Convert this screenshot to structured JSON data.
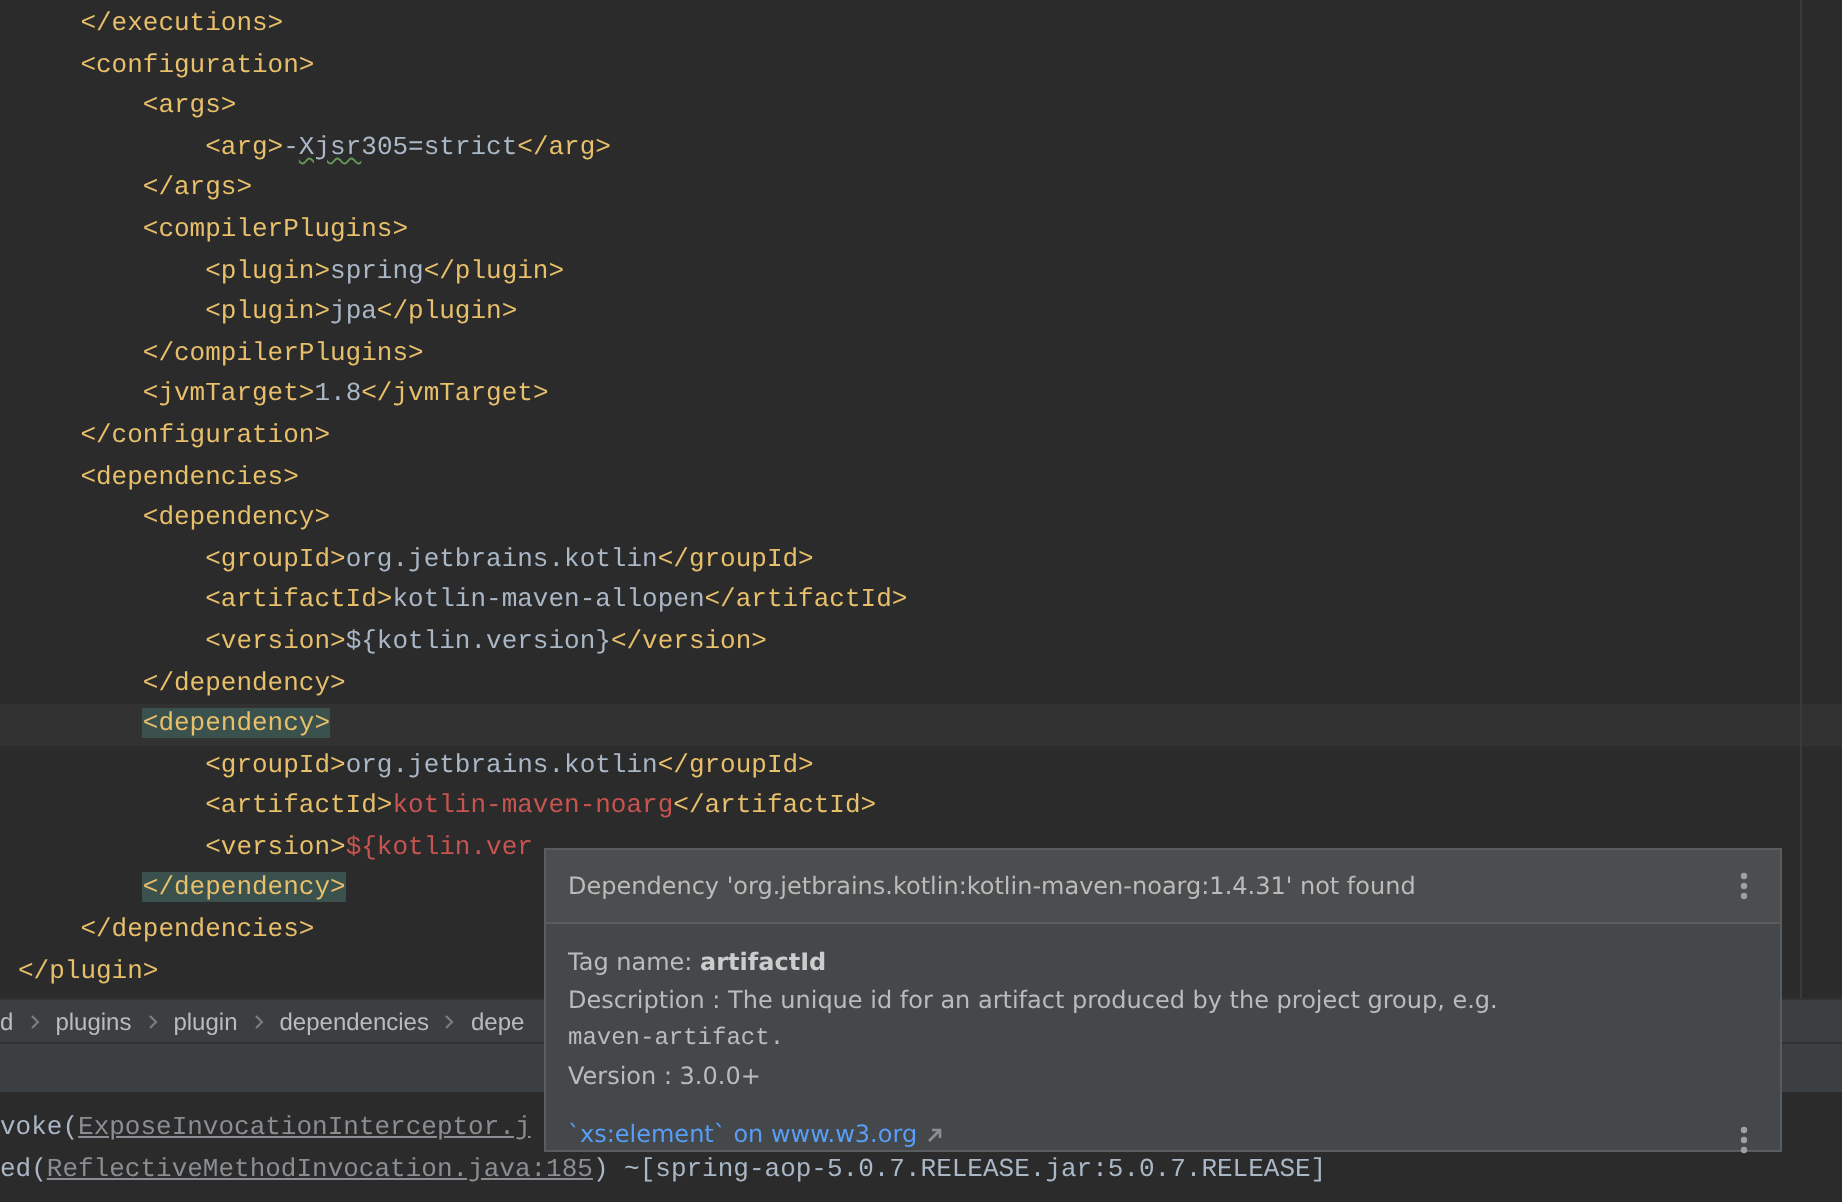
{
  "editor": {
    "lines": [
      {
        "children": [
          {
            "segments": [
              {
                "kind": "tag",
                "text": "</executions>"
              }
            ]
          },
          {
            "segments": [
              {
                "kind": "tag",
                "text": "<configuration>"
              }
            ],
            "children": [
              {
                "segments": [
                  {
                    "kind": "tag",
                    "text": "<args>"
                  }
                ],
                "children": [
                  {
                    "segments": [
                      {
                        "kind": "tag",
                        "text": "<arg>"
                      },
                      {
                        "kind": "text",
                        "text": "-"
                      },
                      {
                        "kind": "typo",
                        "text": "Xjsr"
                      },
                      {
                        "kind": "text",
                        "text": "305=strict"
                      },
                      {
                        "kind": "tag",
                        "text": "</arg>"
                      }
                    ]
                  }
                ]
              },
              {
                "segments": [
                  {
                    "kind": "tag",
                    "text": "</args>"
                  }
                ]
              },
              {
                "segments": [
                  {
                    "kind": "tag",
                    "text": "<compilerPlugins>"
                  }
                ],
                "children": [
                  {
                    "segments": [
                      {
                        "kind": "tag",
                        "text": "<plugin>"
                      },
                      {
                        "kind": "text",
                        "text": "spring"
                      },
                      {
                        "kind": "tag",
                        "text": "</plugin>"
                      }
                    ]
                  },
                  {
                    "segments": [
                      {
                        "kind": "tag",
                        "text": "<plugin>"
                      },
                      {
                        "kind": "text",
                        "text": "jpa"
                      },
                      {
                        "kind": "tag",
                        "text": "</plugin>"
                      }
                    ]
                  }
                ]
              },
              {
                "segments": [
                  {
                    "kind": "tag",
                    "text": "</compilerPlugins>"
                  }
                ]
              },
              {
                "segments": [
                  {
                    "kind": "tag",
                    "text": "<jvmTarget>"
                  },
                  {
                    "kind": "text",
                    "text": "1.8"
                  },
                  {
                    "kind": "tag",
                    "text": "</jvmTarget>"
                  }
                ]
              }
            ]
          },
          {
            "segments": [
              {
                "kind": "tag",
                "text": "</configuration>"
              }
            ]
          },
          {
            "segments": [
              {
                "kind": "tag",
                "text": "<dependencies>"
              }
            ],
            "children": [
              {
                "segments": [
                  {
                    "kind": "tag",
                    "text": "<dependency>"
                  }
                ],
                "children": [
                  {
                    "segments": [
                      {
                        "kind": "tag",
                        "text": "<groupId>"
                      },
                      {
                        "kind": "text",
                        "text": "org.jetbrains.kotlin"
                      },
                      {
                        "kind": "tag",
                        "text": "</groupId>"
                      }
                    ]
                  },
                  {
                    "segments": [
                      {
                        "kind": "tag",
                        "text": "<artifactId>"
                      },
                      {
                        "kind": "text",
                        "text": "kotlin-maven-allopen"
                      },
                      {
                        "kind": "tag",
                        "text": "</artifactId>"
                      }
                    ]
                  },
                  {
                    "segments": [
                      {
                        "kind": "tag",
                        "text": "<version>"
                      },
                      {
                        "kind": "text",
                        "text": "${kotlin.version}"
                      },
                      {
                        "kind": "tag",
                        "text": "</version>"
                      }
                    ]
                  }
                ]
              },
              {
                "segments": [
                  {
                    "kind": "tag",
                    "text": "</dependency>"
                  }
                ]
              },
              {
                "current": true,
                "segments": [
                  {
                    "kind": "matched",
                    "text": "<dependency>"
                  }
                ],
                "children": [
                  {
                    "segments": [
                      {
                        "kind": "tag",
                        "text": "<groupId>"
                      },
                      {
                        "kind": "text",
                        "text": "org.jetbrains.kotlin"
                      },
                      {
                        "kind": "tag",
                        "text": "</groupId>"
                      }
                    ]
                  },
                  {
                    "segments": [
                      {
                        "kind": "tag",
                        "text": "<artifactId>"
                      },
                      {
                        "kind": "error",
                        "text": "kotlin-maven-noarg"
                      },
                      {
                        "kind": "tag",
                        "text": "</artifactId>"
                      }
                    ]
                  },
                  {
                    "segments": [
                      {
                        "kind": "tag",
                        "text": "<version>"
                      },
                      {
                        "kind": "error",
                        "text": "${kotlin.ver"
                      }
                    ]
                  }
                ]
              },
              {
                "segments": [
                  {
                    "kind": "matched",
                    "text": "</dependency>"
                  }
                ]
              }
            ]
          },
          {
            "segments": [
              {
                "kind": "tag",
                "text": "</dependencies>"
              }
            ]
          }
        ]
      },
      {
        "segments": [
          {
            "kind": "tag",
            "text": "</plugin>"
          }
        ]
      }
    ]
  },
  "breadcrumbs": [
    "d",
    "plugins",
    "plugin",
    "dependencies",
    "depe"
  ],
  "console": {
    "lines": [
      [
        {
          "kind": "text",
          "text": "voke("
        },
        {
          "kind": "link",
          "text": "ExposeInvocationInterceptor.j"
        }
      ],
      [
        {
          "kind": "text",
          "text": "ed("
        },
        {
          "kind": "link",
          "text": "ReflectiveMethodInvocation.java:185"
        },
        {
          "kind": "text",
          "text": ") ~[spring-aop-5.0.7.RELEASE.jar:5.0.7.RELEASE]"
        }
      ]
    ]
  },
  "popup": {
    "title": "Dependency 'org.jetbrains.kotlin:kotlin-maven-noarg:1.4.31' not found",
    "tag_name": "Tag name: **artifactId**",
    "description": "Description : The unique id for an artifact produced by the project group, e.g.",
    "example": "maven-artifact.",
    "version": "Version : 3.0.0+",
    "link": "`xs:element` on www.w3.org"
  }
}
